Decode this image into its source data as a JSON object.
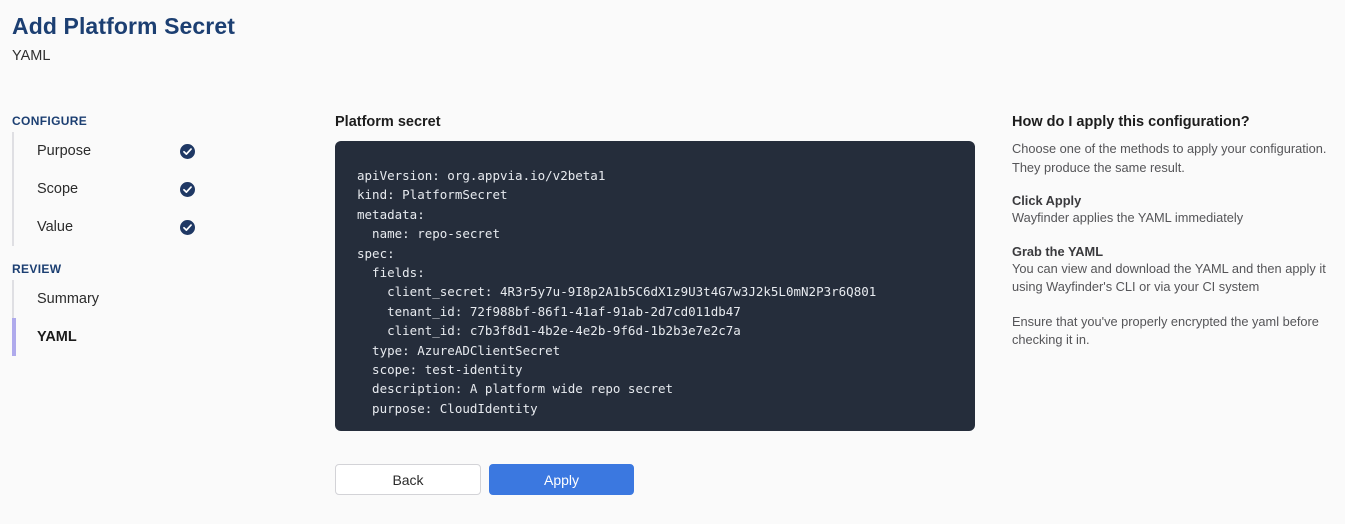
{
  "header": {
    "title": "Add Platform Secret",
    "subtitle": "YAML"
  },
  "sidebar": {
    "sections": [
      {
        "title": "CONFIGURE",
        "items": [
          {
            "label": "Purpose",
            "completed": true,
            "active": false
          },
          {
            "label": "Scope",
            "completed": true,
            "active": false
          },
          {
            "label": "Value",
            "completed": true,
            "active": false
          }
        ]
      },
      {
        "title": "REVIEW",
        "items": [
          {
            "label": "Summary",
            "completed": false,
            "active": false
          },
          {
            "label": "YAML",
            "completed": false,
            "active": true
          }
        ]
      }
    ],
    "check_icon": "check-circle-icon"
  },
  "main": {
    "panel_label": "Platform secret",
    "yaml": "apiVersion: org.appvia.io/v2beta1\nkind: PlatformSecret\nmetadata:\n  name: repo-secret\nspec:\n  fields:\n    client_secret: 4R3r5y7u-9I8p2A1b5C6dX1z9U3t4G7w3J2k5L0mN2P3r6Q801\n    tenant_id: 72f988bf-86f1-41af-91ab-2d7cd011db47\n    client_id: c7b3f8d1-4b2e-4e2b-9f6d-1b2b3e7e2c7a\n  type: AzureADClientSecret\n  scope: test-identity\n  description: A platform wide repo secret\n  purpose: CloudIdentity",
    "back_label": "Back",
    "apply_label": "Apply"
  },
  "help": {
    "title": "How do I apply this configuration?",
    "intro": "Choose one of the methods to apply your configuration. They produce the same result.",
    "blocks": [
      {
        "heading": "Click Apply",
        "body": "Wayfinder applies the YAML immediately"
      },
      {
        "heading": "Grab the YAML",
        "body": "You can view and download the YAML and then apply it using Wayfinder's CLI or via your CI system"
      }
    ],
    "footer": "Ensure that you've properly encrypted the yaml before checking it in."
  },
  "colors": {
    "page_background": "#fafafa",
    "title_navy": "#1c3f72",
    "code_background": "#252d3b",
    "accent_blue": "#3b78e0",
    "active_bar_purple": "#afaaec",
    "check_navy": "#1f3864"
  }
}
